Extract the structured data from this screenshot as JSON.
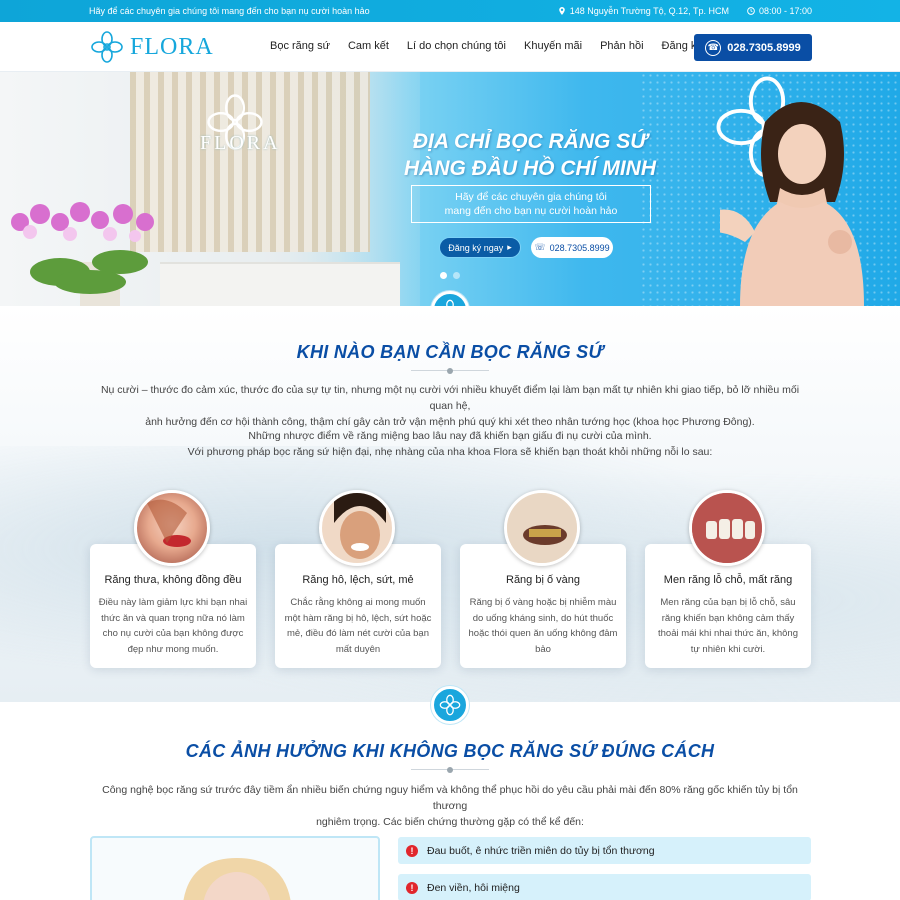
{
  "topbar": {
    "tagline": "Hãy để các chuyên gia chúng tôi mang đến cho bạn nụ cười hoàn hảo",
    "address": "148 Nguyễn Trường Tộ, Q.12, Tp. HCM",
    "hours": "08:00 - 17:00"
  },
  "header": {
    "logo_text": "FLORA",
    "nav": [
      "Bọc răng sứ",
      "Cam kết",
      "Lí do chọn chúng tôi",
      "Khuyến mãi",
      "Phản hồi",
      "Đăng ký khám"
    ],
    "phone": "028.7305.8999"
  },
  "hero": {
    "sign_text": "FLORA",
    "title_line1": "ĐỊA CHỈ BỌC RĂNG SỨ",
    "title_line2": "HÀNG ĐẦU HỒ CHÍ MINH",
    "subtitle_line1": "Hãy để các chuyên gia chúng tôi",
    "subtitle_line2": "mang đến cho bạn nụ cười hoàn hảo",
    "register_label": "Đăng ký ngay",
    "phone": "028.7305.8999"
  },
  "section1": {
    "title": "KHI NÀO BẠN CẦN BỌC RĂNG SỨ",
    "para1_line1": "Nụ cười – thước đo cảm xúc, thước đo của sự tự tin, nhưng một nụ cười với nhiều khuyết điểm lại làm bạn mất tự nhiên khi giao tiếp, bỏ lỡ nhiều mối quan hệ,",
    "para1_line2": "ảnh hưởng đến cơ hội thành công, thậm chí gây cản trở vận mệnh phú quý khi xét theo nhân tướng học (khoa học Phương Đông).",
    "para2_line1": "Những nhược điểm về răng miệng bao lâu nay đã khiến bạn giấu đi nụ cười của mình.",
    "para2_line2": "Với phương pháp bọc răng sứ hiện đại, nhẹ nhàng của nha khoa Flora sẽ khiến bạn thoát khỏi những nỗi lo sau:",
    "cards": [
      {
        "title": "Răng thưa, không đồng đều",
        "text": "Điều này làm giảm lực khi bạn nhai thức ăn và quan trọng nữa nó làm cho nụ cười của bạn không được đẹp như mong muốn."
      },
      {
        "title": "Răng hô, lệch, sứt, mẻ",
        "text": "Chắc rằng không ai mong muốn một hàm răng bị hô, lệch, sứt hoặc mẻ, điều đó làm nét cười của bạn mất duyên"
      },
      {
        "title": "Răng bị ố vàng",
        "text": "Răng bị ố vàng hoặc bị nhiễm màu do uống kháng sinh, do hút thuốc hoặc thói quen ăn uống không đảm bảo"
      },
      {
        "title": "Men răng lỗ chỗ, mất răng",
        "text": "Men răng của bạn bị lỗ chỗ, sâu răng khiến bạn không cảm thấy thoải mái khi nhai thức ăn, không tự nhiên khi cười."
      }
    ]
  },
  "section2": {
    "title": "CÁC ẢNH HƯỞNG KHI KHÔNG BỌC RĂNG SỨ ĐÚNG CÁCH",
    "para_line1": "Công nghệ bọc răng sứ trước đây tiềm ẩn nhiều biến chứng nguy hiểm và không thể phục hồi do yêu cầu phải mài đến 80% răng gốc khiến tủy bị tổn thương",
    "para_line2": "nghiêm trọng. Các biến chứng thường gặp có thể kể đến:",
    "bullets": [
      "Đau buốt, ê nhức triền miên do tủy bị tổn thương",
      "Đen viền, hôi miệng"
    ]
  },
  "colors": {
    "primary": "#0a4ea5",
    "accent": "#16a7dc",
    "warning": "#e1262c"
  }
}
